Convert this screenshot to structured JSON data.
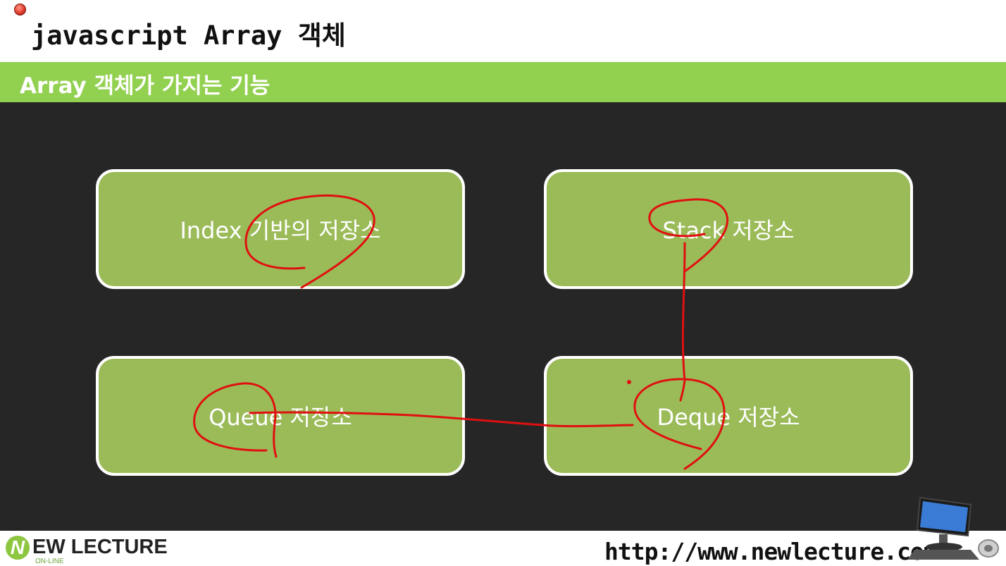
{
  "header": {
    "title": "javascript Array 객체",
    "section_title": "Array 객체가 가지는 기능"
  },
  "cards": [
    {
      "label": "Index 기반의 저장소"
    },
    {
      "label": "Stack 저장소"
    },
    {
      "label": "Queue 저장소"
    },
    {
      "label": "Deque 저장소"
    }
  ],
  "footer": {
    "logo_initial": "N",
    "logo_text": "EW LECTURE",
    "logo_sub": "ON-LINE",
    "url": "http://www.newlecture.com"
  },
  "colors": {
    "accent_green": "#92d050",
    "card_green": "#9bbb59",
    "stage_background": "#262626",
    "annotation_ink": "#e01010"
  }
}
